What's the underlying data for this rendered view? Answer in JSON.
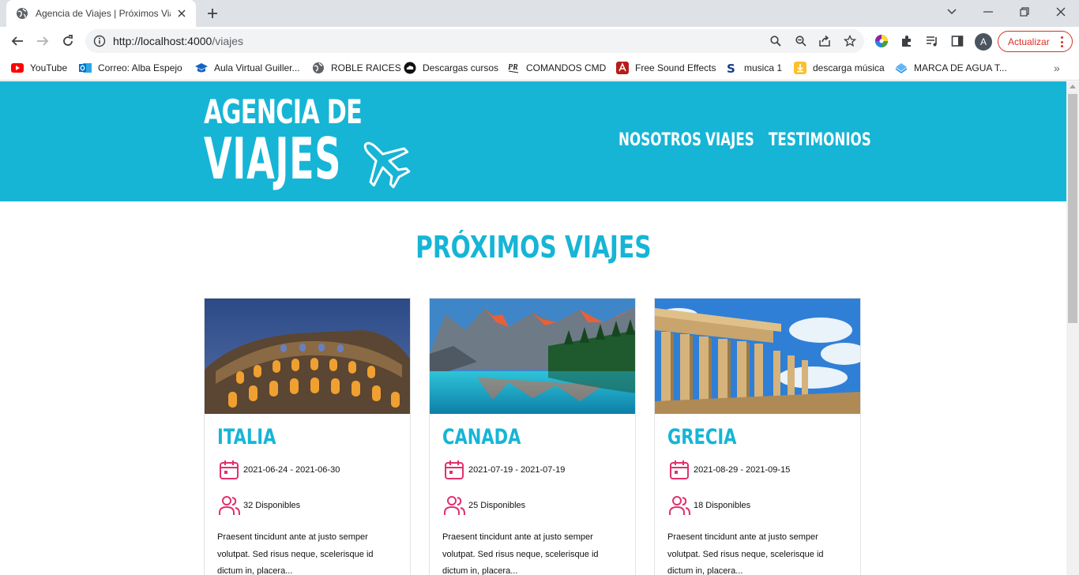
{
  "browser": {
    "tab_title": "Agencia de Viajes | Próximos Viajes",
    "url_host": "http://localhost:4000",
    "url_path": "/viajes",
    "update_label": "Actualizar",
    "profile_initial": "A"
  },
  "bookmarks": [
    {
      "label": "YouTube",
      "icon": "youtube-icon"
    },
    {
      "label": "Correo: Alba Espejo",
      "icon": "outlook-icon"
    },
    {
      "label": "Aula Virtual Guiller...",
      "icon": "graduation-cap-icon"
    },
    {
      "label": "ROBLE RAICES",
      "icon": "globe-icon"
    },
    {
      "label": "Descargas cursos",
      "icon": "download-cloud-icon"
    },
    {
      "label": "COMANDOS CMD",
      "icon": "pr-icon"
    },
    {
      "label": "Free Sound Effects",
      "icon": "sound-effects-icon"
    },
    {
      "label": "musica 1",
      "icon": "s-icon"
    },
    {
      "label": "descarga música",
      "icon": "music-download-icon"
    },
    {
      "label": "MARCA DE AGUA T...",
      "icon": "watermark-icon"
    }
  ],
  "header": {
    "logo_line1": "AGENCIA DE",
    "logo_line2": "VIAJES",
    "nav": [
      "NOSOTROS",
      "VIAJES",
      "TESTIMONIOS"
    ]
  },
  "main": {
    "title": "PRÓXIMOS VIAJES",
    "cards": [
      {
        "title": "ITALIA",
        "dates": "2021-06-24 - 2021-06-30",
        "available": "32 Disponibles",
        "description": "Praesent tincidunt ante at justo semper volutpat. Sed risus neque, scelerisque id dictum in, placera..."
      },
      {
        "title": "CANADA",
        "dates": "2021-07-19 - 2021-07-19",
        "available": "25 Disponibles",
        "description": "Praesent tincidunt ante at justo semper volutpat. Sed risus neque, scelerisque id dictum in, placera..."
      },
      {
        "title": "GRECIA",
        "dates": "2021-08-29 - 2021-09-15",
        "available": "18 Disponibles",
        "description": "Praesent tincidunt ante at justo semper volutpat. Sed risus neque, scelerisque id dictum in, placera..."
      }
    ]
  },
  "colors": {
    "brand": "#16b5d6",
    "accent_icon": "#e0306e",
    "update_red": "#d93025"
  }
}
